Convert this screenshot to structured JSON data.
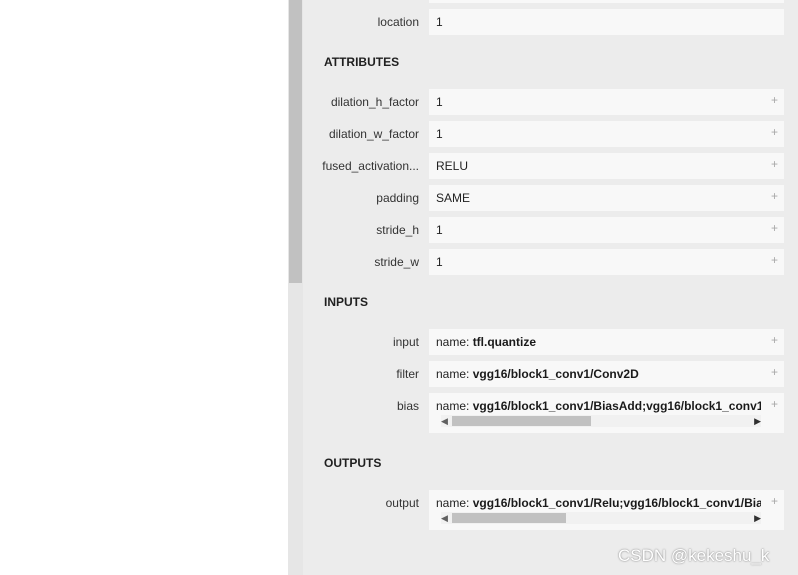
{
  "top": {
    "location_label": "location",
    "location_value": "1"
  },
  "sections": {
    "attributes": "ATTRIBUTES",
    "inputs": "INPUTS",
    "outputs": "OUTPUTS"
  },
  "attributes": [
    {
      "label": "dilation_h_factor",
      "value": "1"
    },
    {
      "label": "dilation_w_factor",
      "value": "1"
    },
    {
      "label": "fused_activation...",
      "value": "RELU"
    },
    {
      "label": "padding",
      "value": "SAME"
    },
    {
      "label": "stride_h",
      "value": "1"
    },
    {
      "label": "stride_w",
      "value": "1"
    }
  ],
  "inputs": [
    {
      "label": "input",
      "prefix": "name: ",
      "name": "tfl.quantize"
    },
    {
      "label": "filter",
      "prefix": "name: ",
      "name": "vgg16/block1_conv1/Conv2D"
    },
    {
      "label": "bias",
      "prefix": "name: ",
      "name": "vgg16/block1_conv1/BiasAdd;vgg16/block1_conv1/"
    }
  ],
  "outputs": [
    {
      "label": "output",
      "prefix": "name: ",
      "name": "vgg16/block1_conv1/Relu;vgg16/block1_conv1/Bias"
    }
  ],
  "expand_symbol": "+",
  "watermark": "CSDN @kekeshu_k"
}
